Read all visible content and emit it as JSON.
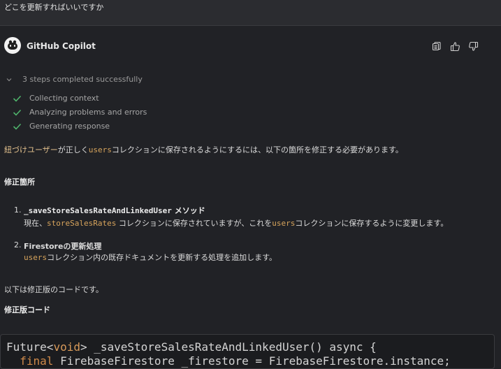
{
  "prompt": {
    "text": "どこを更新すればいいですか"
  },
  "header": {
    "author": "GitHub Copilot",
    "actions": [
      "copy-icon",
      "thumbs-up-icon",
      "thumbs-down-icon"
    ]
  },
  "steps": {
    "summary": "3 steps completed successfully",
    "items": [
      "Collecting context",
      "Analyzing problems and errors",
      "Generating response"
    ]
  },
  "answer": {
    "intro_part1": "紐づけユーザー",
    "intro_part2": "が正しく",
    "intro_code": "users",
    "intro_part3": "コレクションに保存されるようにするには、以下の箇所を修正する必要があります。",
    "section_title": "修正箇所",
    "list": [
      {
        "num": "1.",
        "title_code": "_saveStoreSalesRateAndLinkedUser",
        "title_suffix": " メソッド",
        "body_part1": "現在、",
        "body_code1": "storeSalesRates",
        "body_part2": " コレクションに保存されていますが、これを",
        "body_code2": "users",
        "body_part3": "コレクションに保存するように変更します。"
      },
      {
        "num": "2.",
        "title_text": "Firestoreの更新処理",
        "body_code1": "users",
        "body_part1": "コレクション内の既存ドキュメントを更新する処理を追加します。"
      }
    ],
    "outro": "以下は修正版のコードです。",
    "code_title": "修正版コード"
  },
  "code": {
    "line1_a": "Future<",
    "line1_kw": "void",
    "line1_b": "> _saveStoreSalesRateAndLinkedUser() async {",
    "line2_kw": "  final",
    "line2_b": " FirebaseFirestore _firestore = FirebaseFirestore.instance;"
  },
  "colors": {
    "background": "#212226",
    "highlight_code": "#d7a45c",
    "check_green": "#4fb36b"
  }
}
